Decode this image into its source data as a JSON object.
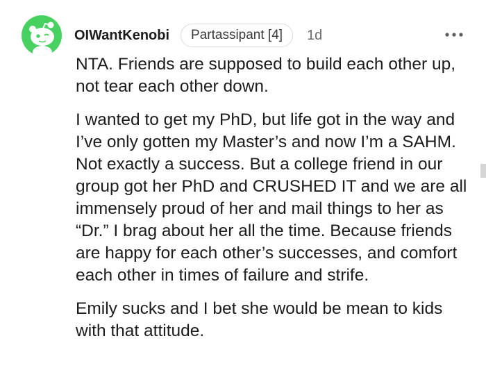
{
  "comment": {
    "username": "OIWantKenobi",
    "flair": "Partassipant [4]",
    "timestamp": "1d",
    "more_icon": "more-horizontal-icon",
    "paragraphs": [
      "NTA. Friends are supposed to build each other up, not tear each other down.",
      "I wanted to get my PhD, but life got in the way and I’ve only gotten my Master’s and now I’m a SAHM. Not exactly a success. But a college friend in our group got her PhD and CRUSHED IT and we are all immensely proud of her and mail things to her as “Dr.” I brag about her all the time. Because friends are happy for each other’s successes, and comfort each other in times of failure and strife.",
      "Emily sucks and I bet she would be mean to kids with that attitude."
    ]
  },
  "colors": {
    "avatar_bg": "#46d160",
    "text": "#1c1c1c",
    "muted": "#6b6b6b",
    "flair_border": "#dadada"
  }
}
